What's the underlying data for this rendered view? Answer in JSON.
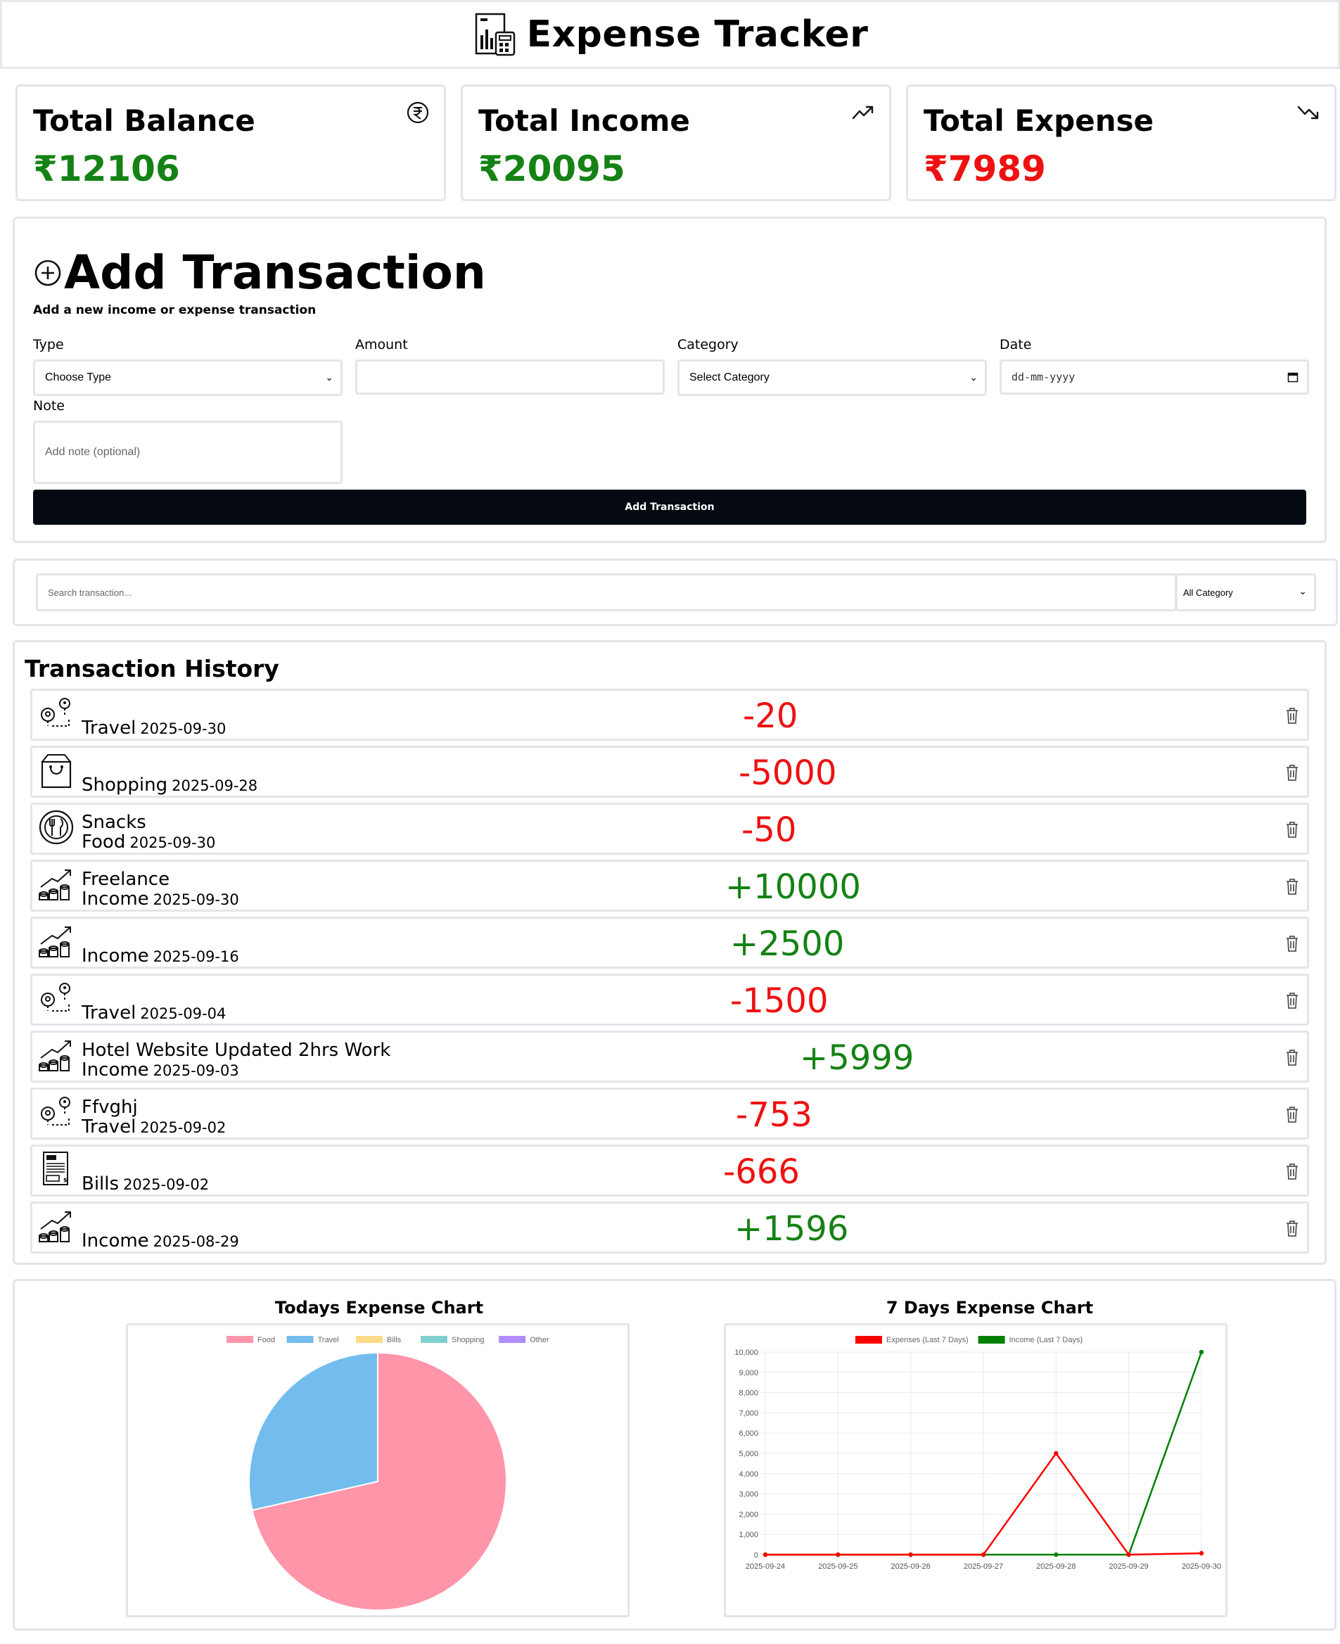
{
  "header": {
    "title": "Expense Tracker",
    "logo_icon": "finance-report-icon"
  },
  "stats": {
    "balance": {
      "label": "Total Balance",
      "value": "₹12106",
      "color": "#148214",
      "icon": "rupee-circle-icon"
    },
    "income": {
      "label": "Total Income",
      "value": "₹20095",
      "color": "#148214",
      "icon": "trending-up-icon"
    },
    "expense": {
      "label": "Total Expense",
      "value": "₹7989",
      "color": "#ee1111",
      "icon": "trending-down-icon"
    }
  },
  "add_form": {
    "title": "Add Transaction",
    "subtitle": "Add a new income or expense transaction",
    "type_label": "Type",
    "type_value": "Choose Type",
    "amount_label": "Amount",
    "amount_value": "",
    "category_label": "Category",
    "category_value": "Select Category",
    "date_label": "Date",
    "date_placeholder": "dd-mm-yyyy",
    "note_label": "Note",
    "note_placeholder": "Add note (optional)",
    "submit_label": "Add Transaction"
  },
  "filter": {
    "search_placeholder": "Search transaction...",
    "category_value": "All Category"
  },
  "history": {
    "title": "Transaction History",
    "items": [
      {
        "note": "",
        "category": "Travel",
        "date": "2025-09-30",
        "amount": "-20",
        "type": "expense",
        "icon": "map-pin-route-icon"
      },
      {
        "note": "",
        "category": "Shopping",
        "date": "2025-09-28",
        "amount": "-5000",
        "type": "expense",
        "icon": "shopping-bag-icon"
      },
      {
        "note": "Snacks",
        "category": "Food",
        "date": "2025-09-30",
        "amount": "-50",
        "type": "expense",
        "icon": "food-plate-icon"
      },
      {
        "note": "Freelance",
        "category": "Income",
        "date": "2025-09-30",
        "amount": "+10000",
        "type": "income",
        "icon": "coins-growth-icon"
      },
      {
        "note": "",
        "category": "Income",
        "date": "2025-09-16",
        "amount": "+2500",
        "type": "income",
        "icon": "coins-growth-icon"
      },
      {
        "note": "",
        "category": "Travel",
        "date": "2025-09-04",
        "amount": "-1500",
        "type": "expense",
        "icon": "map-pin-route-icon"
      },
      {
        "note": "Hotel Website Updated 2hrs Work",
        "category": "Income",
        "date": "2025-09-03",
        "amount": "+5999",
        "type": "income",
        "icon": "coins-growth-icon"
      },
      {
        "note": "Ffvghj",
        "category": "Travel",
        "date": "2025-09-02",
        "amount": "-753",
        "type": "expense",
        "icon": "map-pin-route-icon"
      },
      {
        "note": "",
        "category": "Bills",
        "date": "2025-09-02",
        "amount": "-666",
        "type": "expense",
        "icon": "bill-receipt-icon"
      },
      {
        "note": "",
        "category": "Income",
        "date": "2025-08-29",
        "amount": "+1596",
        "type": "income",
        "icon": "coins-growth-icon"
      }
    ]
  },
  "charts": {
    "today_title": "Todays Expense Chart",
    "week_title": "7 Days Expense Chart"
  },
  "chart_data": [
    {
      "type": "pie",
      "title": "Todays Expense Chart",
      "categories": [
        "Food",
        "Travel",
        "Bills",
        "Shopping",
        "Other"
      ],
      "values": [
        50,
        20,
        0,
        0,
        0
      ],
      "colors": [
        "#ff95a8",
        "#72bcee",
        "#ffdb85",
        "#7fd0cd",
        "#b18cff"
      ],
      "legend": "top"
    },
    {
      "type": "line",
      "title": "7 Days Expense Chart",
      "x": [
        "2025-09-24",
        "2025-09-25",
        "2025-09-26",
        "2025-09-27",
        "2025-09-28",
        "2025-09-29",
        "2025-09-30"
      ],
      "series": [
        {
          "name": "Expenses (Last 7 Days)",
          "values": [
            0,
            0,
            0,
            0,
            5000,
            0,
            70
          ],
          "color": "#ff0000"
        },
        {
          "name": "Income (Last 7 Days)",
          "values": [
            0,
            0,
            0,
            0,
            0,
            0,
            10000
          ],
          "color": "#008000"
        }
      ],
      "ylim": [
        0,
        10000
      ],
      "yticks": [
        0,
        1000,
        2000,
        3000,
        4000,
        5000,
        6000,
        7000,
        8000,
        9000,
        10000
      ],
      "ytick_labels": [
        "0",
        "1,000",
        "2,000",
        "3,000",
        "4,000",
        "5,000",
        "6,000",
        "7,000",
        "8,000",
        "9,000",
        "10,000"
      ],
      "grid": true,
      "legend": "top"
    }
  ]
}
